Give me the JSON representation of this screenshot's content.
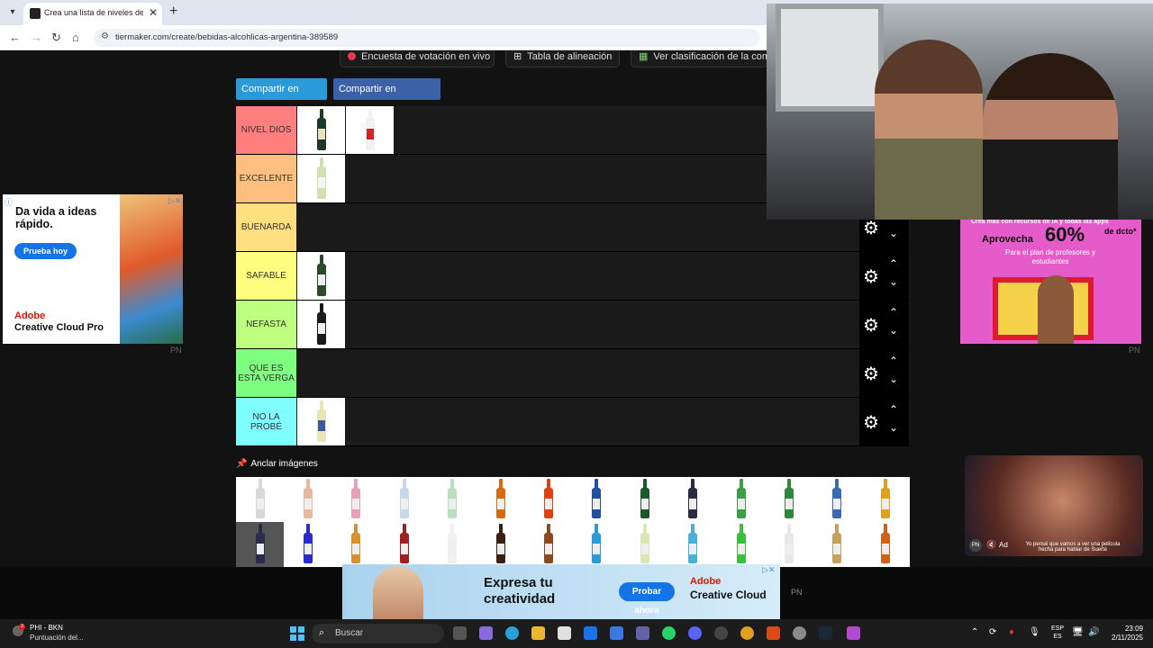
{
  "browser": {
    "tab_title": "Crea una lista de niveles de alc",
    "url": "tiermaker.com/create/bebidas-alcohlicas-argentina-389589"
  },
  "top_buttons": [
    {
      "label": "Encuesta de votación en vivo",
      "icon": "record-dot-icon"
    },
    {
      "label": "Tabla de alineación",
      "icon": "grid-icon"
    },
    {
      "label": "Ver clasificación de la com",
      "icon": "colorful-grid-icon"
    }
  ],
  "share": {
    "twitter": "Compartir en Twitter",
    "facebook": "Compartir en Facebook"
  },
  "tiers": [
    {
      "label": "NIVEL DIOS",
      "color": "#ff7f7f",
      "items": [
        {
          "bottle": "#1e3a22",
          "label": "#e8e0c0"
        },
        {
          "bottle": "#f2f2f2",
          "label": "#d62424"
        }
      ]
    },
    {
      "label": "EXCELENTE",
      "color": "#ffbf7f",
      "items": [
        {
          "bottle": "#cfe2b0",
          "label": "#f5f5f5"
        }
      ]
    },
    {
      "label": "BUENARDA",
      "color": "#ffdf7f",
      "items": []
    },
    {
      "label": "SAFABLE",
      "color": "#ffff7f",
      "items": [
        {
          "bottle": "#2a4a2a",
          "label": "#f0f0f0"
        }
      ]
    },
    {
      "label": "NEFASTA",
      "color": "#bfff7f",
      "items": [
        {
          "bottle": "#1a1a1a",
          "label": "#f0f0f0"
        }
      ]
    },
    {
      "label": "QUE ES ESTA VERGA",
      "color": "#7fff7f",
      "items": []
    },
    {
      "label": "NO LA PROBÉ",
      "color": "#7fffff",
      "items": [
        {
          "bottle": "#e8e6b8",
          "label": "#3a5a9a"
        }
      ]
    }
  ],
  "anchor_label": "Anclar imágenes",
  "pool_bottles": [
    "#d8d8d8",
    "#e9b8a0",
    "#e8a0b8",
    "#c8d8e8",
    "#b8e0c0",
    "#d86a10",
    "#e04010",
    "#1f4fa0",
    "#1a5a2a",
    "#2a2a40",
    "#3aa048",
    "#2a8a3a",
    "#3a6ab0",
    "#e0a020",
    "#2a2a4a",
    "#2a2ad0",
    "#d89030",
    "#a02020",
    "#f0f0f0",
    "#3a2010",
    "#8a4a20",
    "#2a9ad8",
    "#d8e8b0",
    "#4ab0d8",
    "#3ac03a",
    "#e8e8e8",
    "#c8a060",
    "#d0601a"
  ],
  "ads": {
    "left": {
      "headline": "Da vida a ideas rápido.",
      "button": "Prueba hoy",
      "brand": "Adobe",
      "product": "Creative Cloud Pro",
      "badge": "PN"
    },
    "right": {
      "top": "Crea más con recursos de IA y todas las apps",
      "lead": "Aprovecha",
      "percent": "60%",
      "unit": "de dcto*",
      "sub": "Para el plan de profesores y estudiantes",
      "badge": "PN"
    },
    "video": {
      "caption": "Yo pensé que vamos a ver una película hecha para hablar de Suerte",
      "ad_label": "Ad",
      "badge": "PN"
    },
    "bottom": {
      "line1": "Expresa tu",
      "line2": "creatividad",
      "button": "Probar ahora",
      "brand": "Adobe",
      "product": "Creative Cloud",
      "badge": "PN"
    }
  },
  "taskbar": {
    "app_line1": "PHI - BKN",
    "app_line2": "Puntuación del...",
    "notification_count": "3",
    "search_placeholder": "Buscar",
    "lang_line1": "ESP",
    "lang_line2": "ES",
    "time": "23:09",
    "date": "2/11/2025"
  }
}
